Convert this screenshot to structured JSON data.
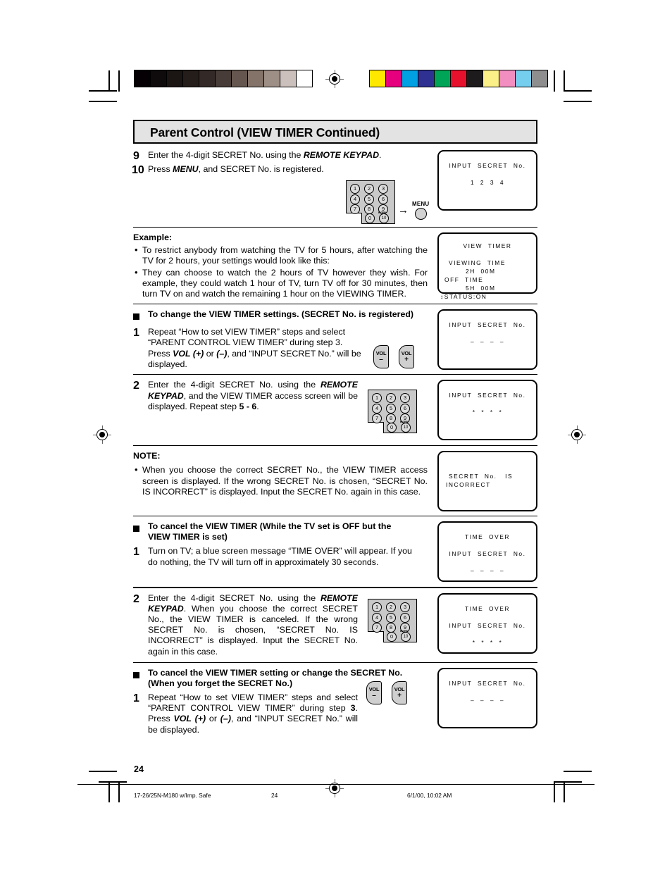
{
  "header": {
    "title": "Parent Control (VIEW TIMER Continued)"
  },
  "colorbars": {
    "grayscale": [
      "#050003",
      "#0f0a0b",
      "#1b1513",
      "#241d1a",
      "#332a27",
      "#473c38",
      "#65574f",
      "#837369",
      "#9d8e86",
      "#cbc0bb",
      "#ffffff"
    ],
    "color": [
      "#ffe800",
      "#e6007e",
      "#00a0e3",
      "#2e3192",
      "#00a457",
      "#e8112d",
      "#1d1b1b",
      "#fbef88",
      "#f28fc0",
      "#76ceee",
      "#8e8e8e"
    ]
  },
  "section_steps_9_10": {
    "steps": [
      {
        "num": "9",
        "text_pre": "Enter the 4-digit SECRET No. using the ",
        "text_bold": "REMOTE KEYPAD",
        "text_post": "."
      },
      {
        "num": "10",
        "text_pre": "Press ",
        "text_bold": "MENU",
        "text_post": ", and SECRET No. is registered."
      }
    ],
    "menu_label": "MENU",
    "arrow": "→",
    "tv": {
      "lines": [
        "INPUT  SECRET  No.",
        "",
        "1  2  3  4"
      ]
    }
  },
  "keypad": {
    "keys": [
      "1",
      "2",
      "3",
      "4",
      "5",
      "6",
      "7",
      "8",
      "9",
      "0",
      "10"
    ],
    "enter_label": "ENTER"
  },
  "vol": {
    "minus_label": "VOL",
    "minus_sign": "–",
    "plus_label": "VOL",
    "plus_sign": "+"
  },
  "example": {
    "heading": "Example:",
    "bullets": [
      "To restrict anybody from watching the TV for 5 hours, after watching the TV for 2 hours, your settings would look like this:",
      "They can choose to watch the 2 hours of TV however they wish. For example, they could watch 1 hour of TV, turn TV off for 30 minutes, then turn TV on and watch the remaining 1 hour on the VIEWING TIMER."
    ],
    "tv": {
      "line1": "VIEW  TIMER",
      "line2": "VIEWING  TIME",
      "line3": "2H  00M",
      "line4": "OFF  TIME",
      "line5": "5H  00M",
      "line6": "↕STATUS:ON"
    }
  },
  "change_settings": {
    "heading": "To change the VIEW TIMER settings. (SECRET No. is registered)",
    "step1": {
      "num": "1",
      "p1": "Repeat “How to set VIEW TIMER” steps and select “PARENT CONTROL VIEW TIMER” during step 3. Press ",
      "b1": "VOL (+)",
      "p2": " or ",
      "b2": "(–)",
      "p3": ", and “INPUT SECRET No.” will be displayed."
    },
    "tv1": {
      "lines": [
        "INPUT  SECRET  No.",
        "",
        "–  –  –  –"
      ]
    },
    "step2": {
      "num": "2",
      "p1": "Enter the 4-digit SECRET No. using the ",
      "b1": "REMOTE KEYPAD",
      "p2": ", and the VIEW TIMER access screen will be displayed. Repeat step ",
      "b2": "5 - 6",
      "p3": "."
    },
    "tv2": {
      "lines": [
        "INPUT  SECRET  No.",
        "",
        "*  *  *  *"
      ]
    }
  },
  "note": {
    "heading": "NOTE:",
    "bullets": [
      "When you choose the correct SECRET No., the VIEW TIMER access screen is displayed. If the wrong SECRET No. is chosen, “SECRET No. IS INCORRECT” is displayed. Input the SECRET No. again in this case."
    ],
    "tv": {
      "line1": "SECRET  No.   IS",
      "line2": "INCORRECT"
    }
  },
  "cancel_off": {
    "heading": "To cancel the VIEW TIMER (While the TV set is OFF but the VIEW TIMER is set)",
    "step1": {
      "num": "1",
      "text": "Turn on TV; a blue screen message “TIME OVER” will appear. If you do nothing, the TV will turn off in approximately 30 seconds."
    },
    "tv1": {
      "lines": [
        "TIME  OVER",
        "",
        "INPUT  SECRET  No.",
        "",
        "–  –  –  –"
      ]
    },
    "step2": {
      "num": "2",
      "p1": "Enter the 4-digit SECRET No. using the ",
      "b1": "REMOTE KEYPAD",
      "p2": ". When you choose the correct SECRET No., the VIEW TIMER is canceled. If the wrong SECRET No. is chosen, “SECRET No. IS INCORRECT” is displayed. Input the SECRET No. again in this case."
    },
    "tv2": {
      "lines": [
        "TIME  OVER",
        "",
        "INPUT  SECRET  No.",
        "",
        "*  *  *  *"
      ]
    }
  },
  "cancel_forgot": {
    "heading": "To cancel the VIEW TIMER setting or change the SECRET No. (When you forget the SECRET No.)",
    "step1": {
      "num": "1",
      "p1": "Repeat “How to set VIEW TIMER” steps and select “PARENT CONTROL VIEW TIMER” during step ",
      "b1": "3",
      "p2": ". Press ",
      "b2": "VOL (+)",
      "p3": " or ",
      "b3": "(–)",
      "p4": ", and “INPUT SECRET No.” will be displayed."
    },
    "tv": {
      "lines": [
        "INPUT  SECRET  No.",
        "",
        "–  –  –  –"
      ]
    }
  },
  "footer": {
    "page_number": "24",
    "doc_id": "17-26/25N-M180 w/Imp. Safe",
    "foot_page": "24",
    "timestamp": "6/1/00, 10:02 AM"
  }
}
